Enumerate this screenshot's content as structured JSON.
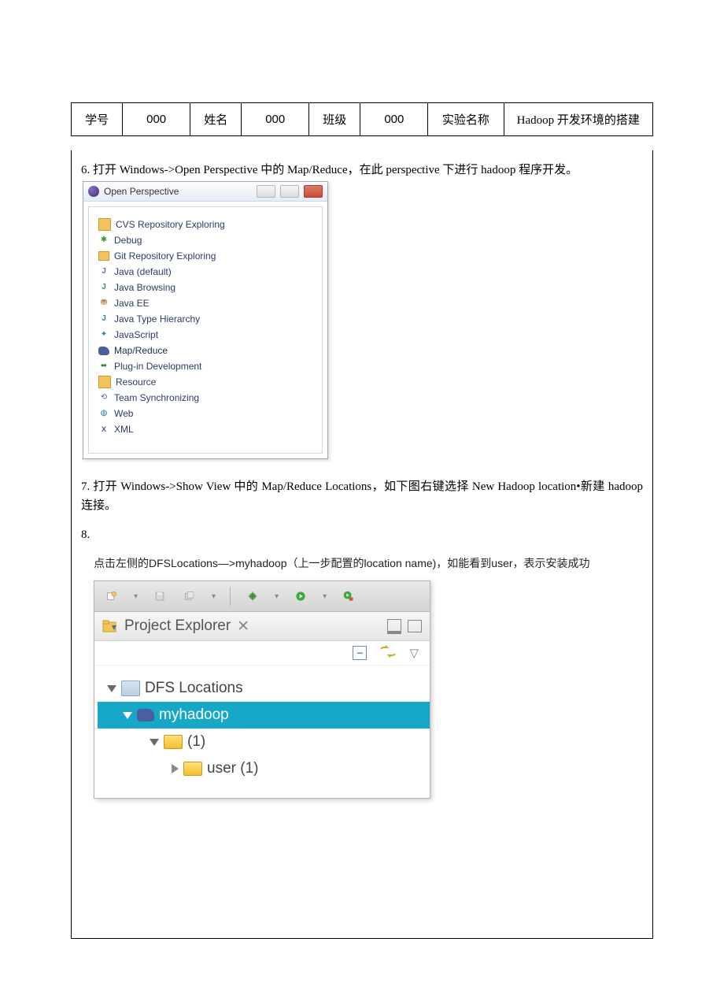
{
  "header": {
    "sid_label": "学号",
    "sid_value": "000",
    "name_label": "姓名",
    "name_value": "000",
    "class_label": "班级",
    "class_value": "000",
    "exp_label": "实验名称",
    "exp_value": "Hadoop 开发环境的搭建"
  },
  "p6": "6. 打开 Windows->Open Perspective 中的 Map/Reduce，在此 perspective 下进行 hadoop 程序开发。",
  "perspective_dialog": {
    "title": "Open Perspective",
    "items": [
      "CVS Repository Exploring",
      "Debug",
      "Git Repository Exploring",
      "Java (default)",
      "Java Browsing",
      "Java EE",
      "Java Type Hierarchy",
      "JavaScript",
      "Map/Reduce",
      "Plug-in Development",
      "Resource",
      "Team Synchronizing",
      "Web",
      "XML"
    ]
  },
  "p7": "7. 打开  Windows->Show View 中的 Map/Reduce Locations，如下图右键选择   New Hadoop location•新建 hadoop 连接。",
  "p8": "8.",
  "pe_note": "点击左侧的DFSLocations—>myhadoop（上一步配置的location name)，如能看到user，表示安装成功",
  "project_explorer": {
    "tab": "Project Explorer",
    "root": "DFS Locations",
    "conn": "myhadoop",
    "folder1": "(1)",
    "folder2": "user (1)"
  }
}
